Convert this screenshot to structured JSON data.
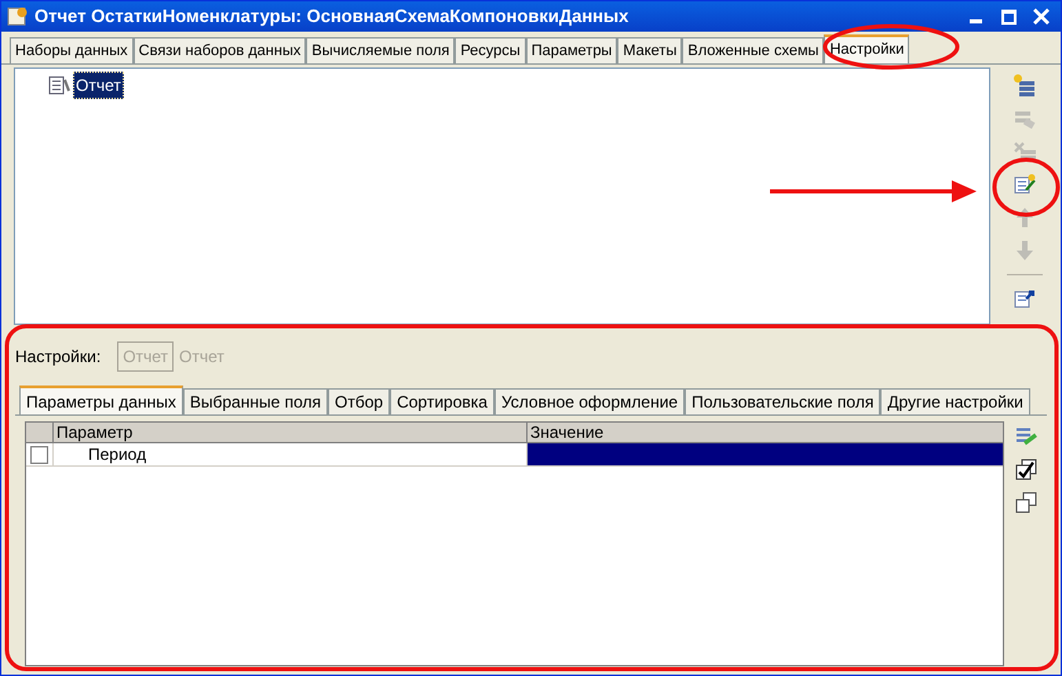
{
  "window": {
    "title": "Отчет ОстаткиНоменклатуры: ОсновнаяСхемаКомпоновкиДанных"
  },
  "tabs": [
    {
      "label": "Наборы данных",
      "selected": false
    },
    {
      "label": "Связи наборов данных",
      "selected": false
    },
    {
      "label": "Вычисляемые поля",
      "selected": false
    },
    {
      "label": "Ресурсы",
      "selected": false
    },
    {
      "label": "Параметры",
      "selected": false
    },
    {
      "label": "Макеты",
      "selected": false
    },
    {
      "label": "Вложенные схемы",
      "selected": false
    },
    {
      "label": "Настройки",
      "selected": true
    }
  ],
  "tree": {
    "items": [
      {
        "label": "Отчет",
        "selected": true
      }
    ]
  },
  "toolbar": [
    {
      "kind": "add",
      "disabled": false
    },
    {
      "kind": "group",
      "disabled": true
    },
    {
      "kind": "delete",
      "disabled": true
    },
    {
      "kind": "wizard",
      "disabled": false
    },
    {
      "kind": "up",
      "disabled": true
    },
    {
      "kind": "down",
      "disabled": true
    },
    {
      "kind": "separator"
    },
    {
      "kind": "restore",
      "disabled": false
    }
  ],
  "settings": {
    "label": "Настройки:",
    "button": "Отчет",
    "name": "Отчет"
  },
  "settings_tabs": [
    {
      "label": "Параметры данных",
      "selected": true
    },
    {
      "label": "Выбранные поля",
      "selected": false
    },
    {
      "label": "Отбор",
      "selected": false
    },
    {
      "label": "Сортировка",
      "selected": false
    },
    {
      "label": "Условное оформление",
      "selected": false
    },
    {
      "label": "Пользовательские поля",
      "selected": false
    },
    {
      "label": "Другие настройки",
      "selected": false
    }
  ],
  "table": {
    "columns": [
      "Параметр",
      "Значение"
    ],
    "rows": [
      {
        "checked": false,
        "parameter": "Период",
        "value_selected": true
      }
    ]
  },
  "side_tools": [
    {
      "kind": "edit"
    },
    {
      "kind": "check"
    },
    {
      "kind": "copy"
    }
  ]
}
